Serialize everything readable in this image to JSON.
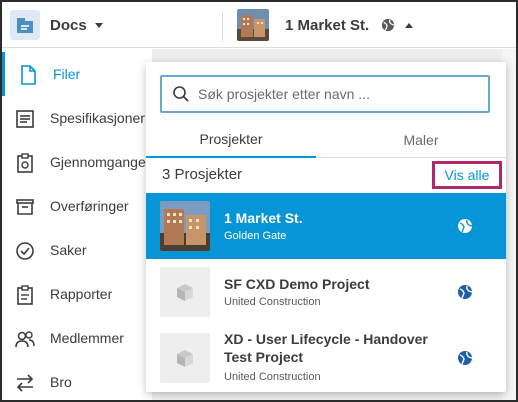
{
  "topbar": {
    "app_name": "Docs",
    "project_name": "1 Market St."
  },
  "sidebar": {
    "items": [
      {
        "label": "Filer",
        "icon": "document-icon",
        "active": true
      },
      {
        "label": "Spesifikasjoner",
        "icon": "list-icon",
        "active": false
      },
      {
        "label": "Gjennomganger",
        "icon": "review-icon",
        "active": false
      },
      {
        "label": "Overføringer",
        "icon": "transfer-icon",
        "active": false
      },
      {
        "label": "Saker",
        "icon": "check-circle-icon",
        "active": false
      },
      {
        "label": "Rapporter",
        "icon": "report-icon",
        "active": false
      },
      {
        "label": "Medlemmer",
        "icon": "people-icon",
        "active": false
      },
      {
        "label": "Bro",
        "icon": "bridge-arrows-icon",
        "active": false
      }
    ]
  },
  "panel": {
    "search_placeholder": "Søk prosjekter etter navn ...",
    "tabs": [
      "Prosjekter",
      "Maler"
    ],
    "count_label": "3 Prosjekter",
    "see_all": "Vis alle",
    "projects": [
      {
        "name": "1 Market St.",
        "company": "Golden Gate",
        "selected": true
      },
      {
        "name": "SF CXD Demo Project",
        "company": "United Construction",
        "selected": false
      },
      {
        "name": "XD - User Lifecycle - Handover Test Project",
        "company": "United Construction",
        "selected": false
      }
    ]
  },
  "colors": {
    "accent": "#0696d7",
    "highlight_border": "#b0286b",
    "search_border": "#69a8d4"
  }
}
